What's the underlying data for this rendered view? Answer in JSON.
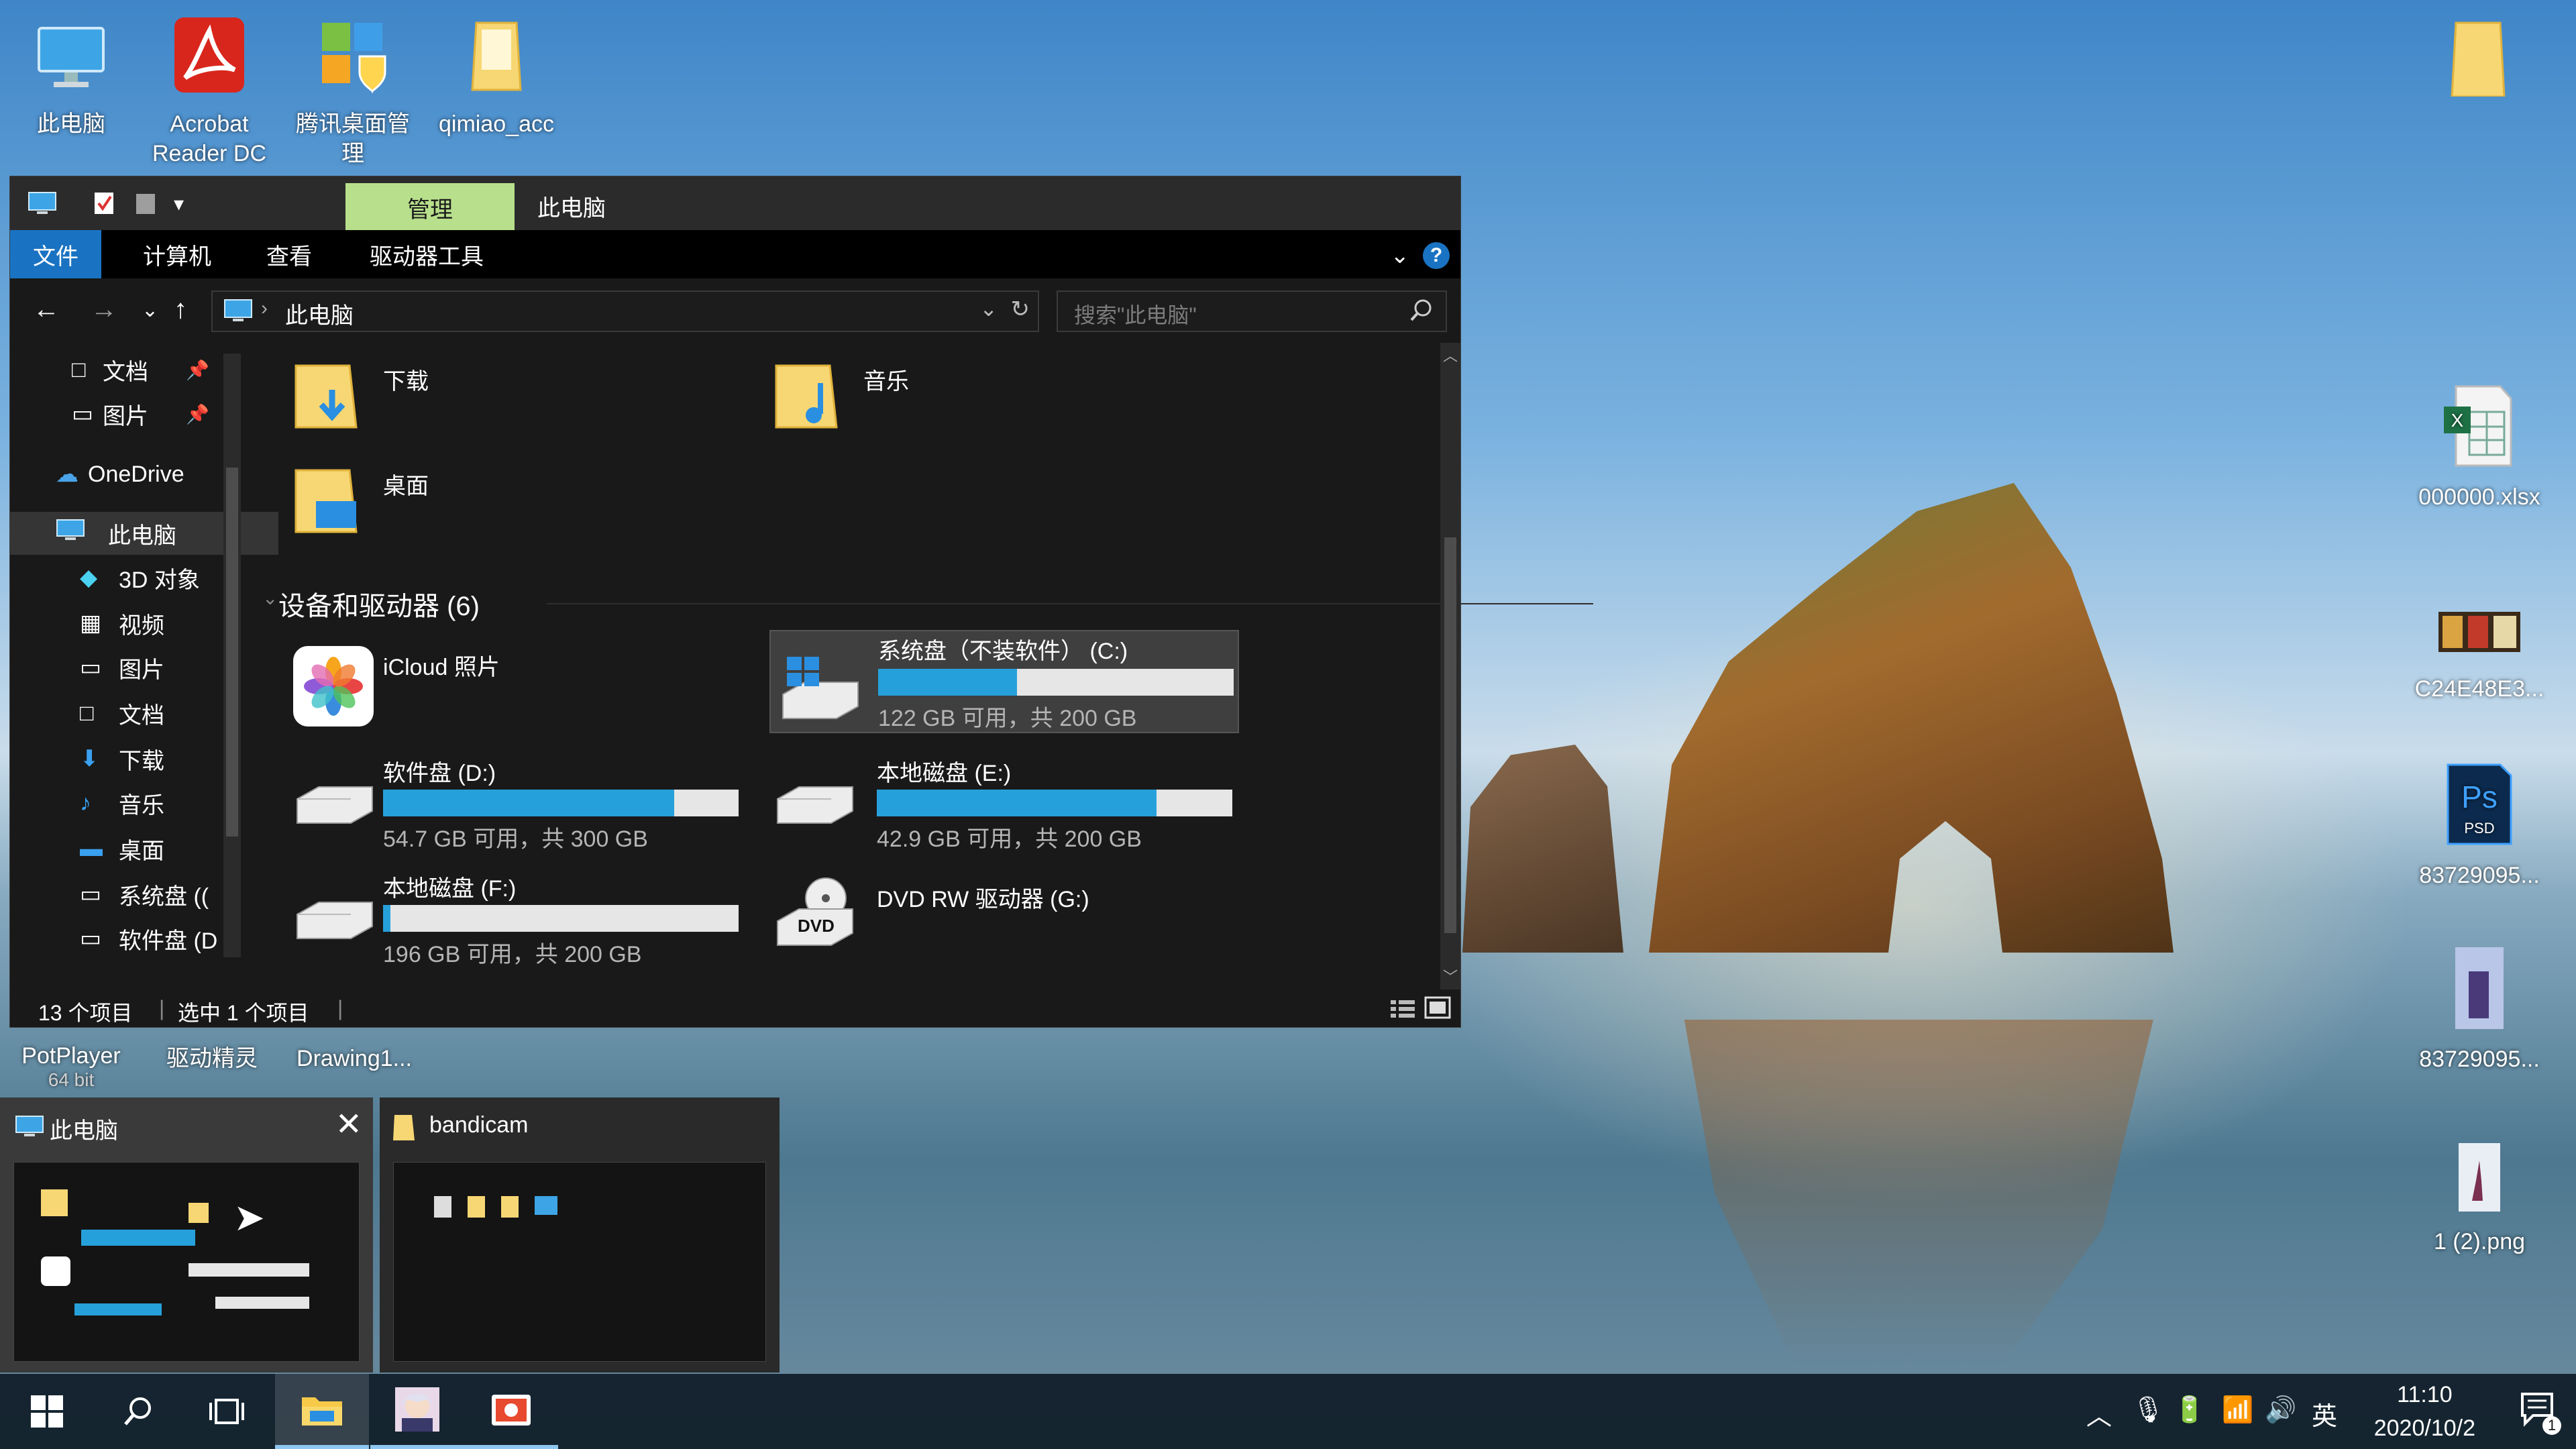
{
  "desktop": {
    "icons": [
      {
        "id": "pc",
        "label": "此电脑"
      },
      {
        "id": "acrobat",
        "label": "Acrobat Reader DC"
      },
      {
        "id": "tencent",
        "label": "腾讯桌面管理"
      },
      {
        "id": "qimiao",
        "label": "qimiao_acc"
      },
      {
        "id": "xlsx",
        "label": "000000.xlsx"
      },
      {
        "id": "c24",
        "label": "C24E48E3..."
      },
      {
        "id": "psd",
        "label": "83729095..."
      },
      {
        "id": "img",
        "label": "83729095..."
      },
      {
        "id": "png",
        "label": "1 (2).png"
      },
      {
        "id": "potplayer",
        "label": "PotPlayer"
      },
      {
        "id": "potplayer2",
        "label": "64 bit"
      },
      {
        "id": "drivergenius",
        "label": "驱动精灵"
      },
      {
        "id": "drawing",
        "label": "Drawing1..."
      }
    ]
  },
  "explorer": {
    "manage_tab": "管理",
    "window_title": "此电脑",
    "ribbon_tabs": [
      "文件",
      "计算机",
      "查看",
      "驱动器工具"
    ],
    "address_path": "此电脑",
    "search_placeholder": "搜索\"此电脑\"",
    "nav_items": [
      {
        "label": "文档",
        "pinned": true
      },
      {
        "label": "图片",
        "pinned": true
      },
      {
        "label": "OneDrive"
      },
      {
        "label": "此电脑",
        "selected": true
      },
      {
        "label": "3D 对象"
      },
      {
        "label": "视频"
      },
      {
        "label": "图片"
      },
      {
        "label": "文档"
      },
      {
        "label": "下载"
      },
      {
        "label": "音乐"
      },
      {
        "label": "桌面"
      },
      {
        "label": "系统盘 (("
      },
      {
        "label": "软件盘 (D"
      }
    ],
    "folders": [
      {
        "label": "下载"
      },
      {
        "label": "音乐"
      },
      {
        "label": "桌面"
      }
    ],
    "group_header": "设备和驱动器 (6)",
    "drives": [
      {
        "label": "iCloud 照片",
        "sub": "",
        "used": null
      },
      {
        "label": "系统盘（不装软件） (C:)",
        "sub": "122 GB 可用，共 200 GB",
        "used": 0.39,
        "selected": true
      },
      {
        "label": "软件盘 (D:)",
        "sub": "54.7 GB 可用，共 300 GB",
        "used": 0.818
      },
      {
        "label": "本地磁盘 (E:)",
        "sub": "42.9 GB 可用，共 200 GB",
        "used": 0.786
      },
      {
        "label": "本地磁盘 (F:)",
        "sub": "196 GB 可用，共 200 GB",
        "used": 0.02
      },
      {
        "label": "DVD RW 驱动器 (G:)",
        "sub": "",
        "used": null
      }
    ],
    "dvd_badge": "DVD",
    "status_items": "13 个项目",
    "status_selected": "选中 1 个项目"
  },
  "taskbar": {
    "previews": [
      {
        "title": "此电脑"
      },
      {
        "title": "bandicam"
      }
    ],
    "ime": "英",
    "time": "11:10",
    "date": "2020/10/2",
    "notifications_count": "1"
  },
  "colors": {
    "accent": "#1a73c2",
    "manage_tab": "#b8e08c",
    "drive_bar": "#26a0da"
  }
}
